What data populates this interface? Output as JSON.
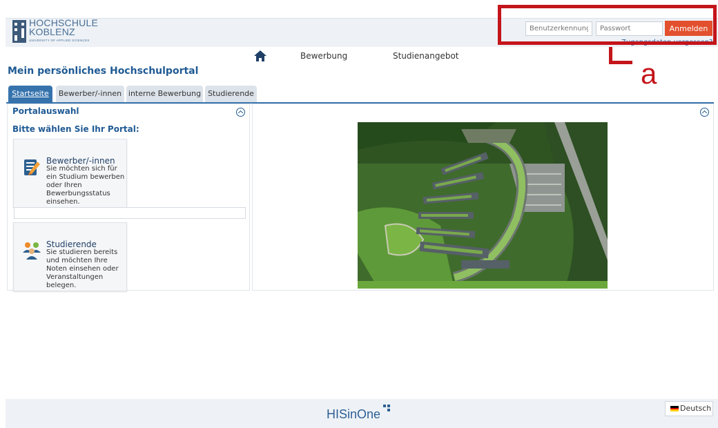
{
  "header": {
    "logo_name_line1": "HOCHSCHULE",
    "logo_name_line2": "KOBLENZ",
    "logo_sub": "UNIVERSITY OF APPLIED SCIENCES",
    "login": {
      "username_placeholder": "Benutzerkennung",
      "password_placeholder": "Passwort",
      "login_label": "Anmelden",
      "forgot_label": "Zugangsdaten vergessen?"
    }
  },
  "annotation": {
    "label": "a",
    "color": "#c4151b"
  },
  "topnav": {
    "home_icon": "home-icon",
    "items": [
      "Bewerbung",
      "Studienangebot"
    ]
  },
  "page_title": "Mein persönliches Hochschulportal",
  "tabs": [
    {
      "label": "Startseite",
      "active": true
    },
    {
      "label": "Bewerber/-innen",
      "active": false
    },
    {
      "label": "interne Bewerbung",
      "active": false
    },
    {
      "label": "Studierende",
      "active": false
    }
  ],
  "left_panel": {
    "title": "Portalauswahl",
    "subtitle": "Bitte wählen Sie Ihr Portal:",
    "cards": [
      {
        "title": "Bewerber/-innen",
        "text": "Sie möchten sich für ein Studium bewerben oder Ihren Bewerbungsstatus einsehen.",
        "icon": "application-form-icon"
      },
      {
        "title": "Studierende",
        "text": "Sie studieren bereits und möchten Ihre Noten einsehen oder Veranstaltungen belegen.",
        "icon": "students-icon"
      }
    ]
  },
  "right_panel": {
    "image": "campus-aerial-photo"
  },
  "footer": {
    "logo": "HISinOne",
    "language_label": "Deutsch",
    "flag_icon": "german-flag-icon"
  },
  "colors": {
    "accent": "#3673ad",
    "title_blue": "#1f5a94",
    "login_button": "#e2502d",
    "header_bg": "#eef2f6"
  }
}
